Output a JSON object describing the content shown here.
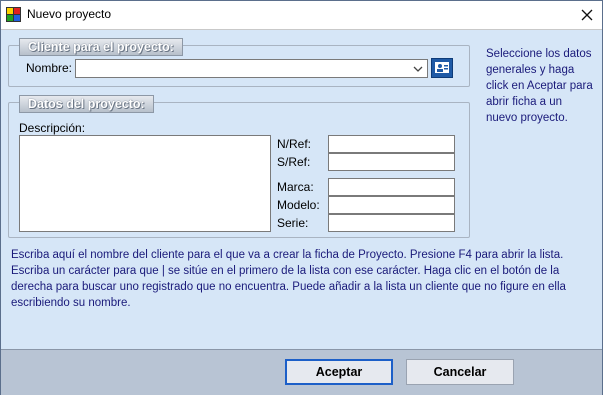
{
  "window": {
    "title": "Nuevo proyecto"
  },
  "cliente_section": {
    "legend": "Cliente para el proyecto:",
    "nombre_label": "Nombre:",
    "nombre_value": ""
  },
  "datos_section": {
    "legend": "Datos del proyecto:",
    "descripcion_label": "Descripción:",
    "descripcion_value": "",
    "fields": [
      {
        "label": "N/Ref:",
        "value": ""
      },
      {
        "label": "S/Ref:",
        "value": ""
      },
      {
        "label": "Marca:",
        "value": ""
      },
      {
        "label": "Modelo:",
        "value": ""
      },
      {
        "label": "Serie:",
        "value": ""
      }
    ]
  },
  "side_help": "Seleccione los datos generales y haga click en Aceptar para abrir ficha a un nuevo proyecto.",
  "bottom_help": "Escriba aquí el nombre del cliente para el que va a crear la ficha de Proyecto. Presione F4 para abrir la lista. Escriba un carácter para que | se sitúe en el primero de la lista con ese carácter. Haga clic en el botón de la derecha para buscar uno registrado que no encuentra. Puede añadir a la lista un cliente que no figure en ella escribiendo su nombre.",
  "buttons": {
    "accept": "Aceptar",
    "cancel": "Cancelar"
  },
  "icons": {
    "app": "app-grid-icon",
    "close": "close-icon",
    "dropdown": "chevron-down-icon",
    "search_client": "contact-card-icon"
  }
}
